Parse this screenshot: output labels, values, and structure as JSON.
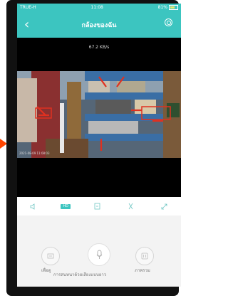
{
  "status_bar": {
    "carrier": "TRUE-H",
    "time": "11:08",
    "battery": "81%"
  },
  "nav": {
    "title": "กล้องของฉัน"
  },
  "video": {
    "speed": "67.2 KB/s",
    "timestamp": "2021-08-09 11:08:03"
  },
  "toolbar": {
    "quality_label": "HD"
  },
  "controls": {
    "history_label": "เพื่อดู",
    "album_label": "ภาพรวม",
    "mic_caption": "การสนทนาด้วยเสียงแบบยาว"
  },
  "colors": {
    "accent": "#3cc5c0",
    "arrow": "#ff4500"
  }
}
